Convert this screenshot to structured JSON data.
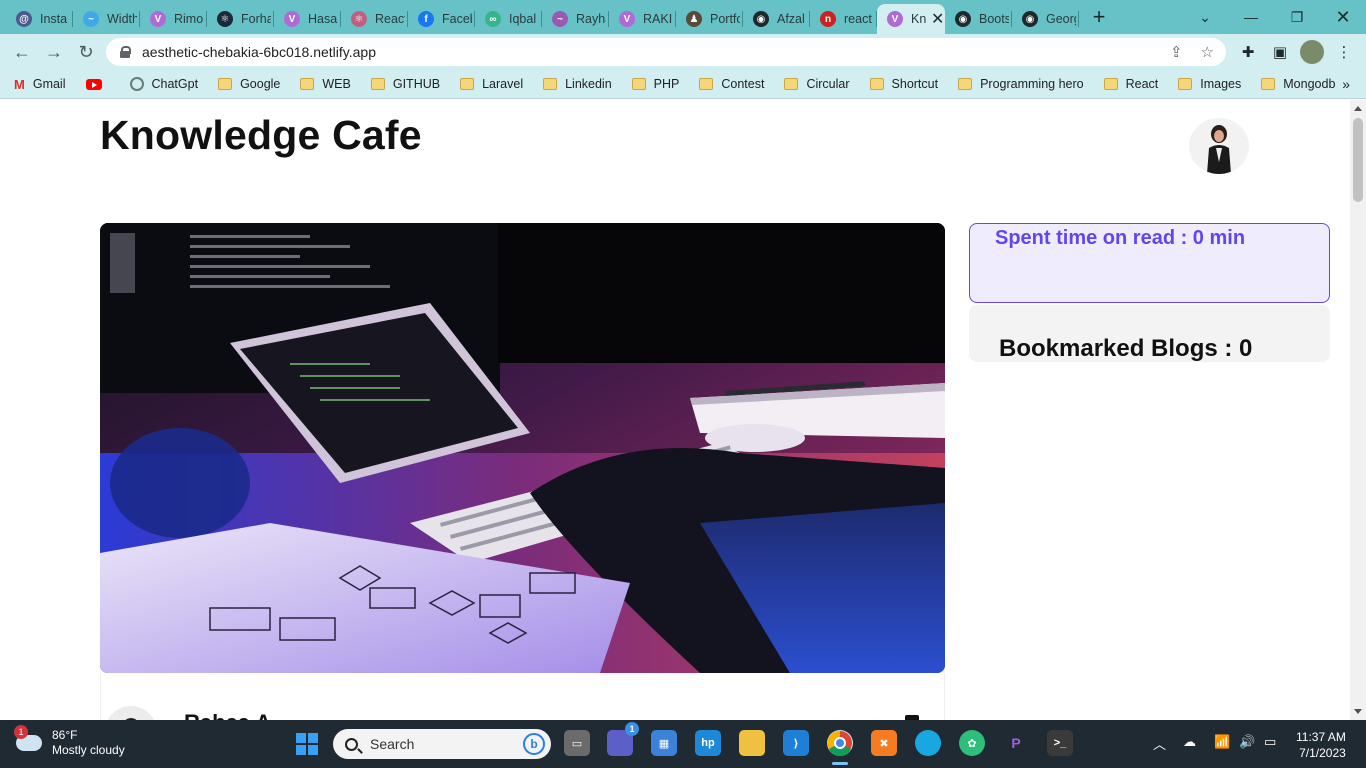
{
  "browser": {
    "tabs": [
      {
        "title": "Insta",
        "color": "#4a5a8c",
        "glyph": "@"
      },
      {
        "title": "Width",
        "color": "#3fa8e8",
        "glyph": "~"
      },
      {
        "title": "Rimo",
        "color": "#b06ad6",
        "glyph": "V"
      },
      {
        "title": "Forha",
        "color": "#1a2a3a",
        "glyph": "⚛"
      },
      {
        "title": "Hasan",
        "color": "#b06ad6",
        "glyph": "V"
      },
      {
        "title": "React",
        "color": "#c06080",
        "glyph": "⚛"
      },
      {
        "title": "Faceb",
        "color": "#1877f2",
        "glyph": "f"
      },
      {
        "title": "Iqbal",
        "color": "#38b48b",
        "glyph": "∞"
      },
      {
        "title": "Rayha",
        "color": "#9b59b6",
        "glyph": "~"
      },
      {
        "title": "RAKI",
        "color": "#b06ad6",
        "glyph": "V"
      },
      {
        "title": "Portfo",
        "color": "#5a4a3a",
        "glyph": "♟"
      },
      {
        "title": "Afzal",
        "color": "#1d2a2b",
        "glyph": "◉"
      },
      {
        "title": "react",
        "color": "#cc2222",
        "glyph": "n"
      }
    ],
    "active_tab": {
      "title": "Kn",
      "color": "#b06ad6",
      "glyph": "V"
    },
    "trailing_tabs": [
      {
        "title": "Boots",
        "color": "#1d2a2b",
        "glyph": "◉"
      },
      {
        "title": "Georg",
        "color": "#1d2a2b",
        "glyph": "◉"
      }
    ],
    "url": "aesthetic-chebakia-6bc018.netlify.app",
    "bookmarks": [
      {
        "label": "Gmail",
        "kind": "gmail"
      },
      {
        "label": "",
        "kind": "youtube"
      },
      {
        "label": "ChatGpt",
        "kind": "chatgpt"
      },
      {
        "label": "Google",
        "kind": "folder"
      },
      {
        "label": "WEB",
        "kind": "folder"
      },
      {
        "label": "GITHUB",
        "kind": "folder"
      },
      {
        "label": "Laravel",
        "kind": "folder"
      },
      {
        "label": "Linkedin",
        "kind": "folder"
      },
      {
        "label": "PHP",
        "kind": "folder"
      },
      {
        "label": "Contest",
        "kind": "folder"
      },
      {
        "label": "Circular",
        "kind": "folder"
      },
      {
        "label": "Shortcut",
        "kind": "folder"
      },
      {
        "label": "Programming hero",
        "kind": "folder"
      },
      {
        "label": "React",
        "kind": "folder"
      },
      {
        "label": "Images",
        "kind": "folder"
      },
      {
        "label": "Mongodb",
        "kind": "folder"
      }
    ],
    "colors": {
      "tabstrip": "#66c2c7",
      "toolbar": "#d3eef0"
    }
  },
  "page": {
    "site_title": "Knowledge Cafe",
    "spent_time": "Spent time on read : 0 min",
    "bookmarked": "Bookmarked Blogs : 0",
    "author_peek": "Rabea A",
    "colors": {
      "accent": "#6047ec",
      "accent_bg": "#efecfd"
    }
  },
  "taskbar": {
    "weather_temp": "86°F",
    "weather_desc": "Mostly cloudy",
    "weather_badge": "1",
    "search_label": "Search",
    "chat_badge": "1",
    "time": "11:37 AM",
    "date": "7/1/2023"
  }
}
